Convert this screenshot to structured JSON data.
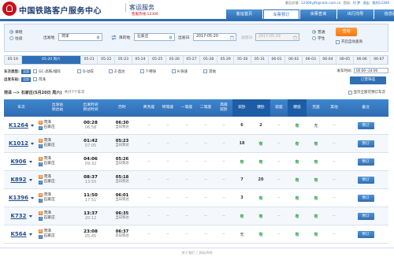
{
  "header": {
    "title": "中国铁路客户服务中心",
    "subtitle": "客运服务",
    "hotline": "客服热线:12306",
    "top_links": [
      "意见反馈:",
      "12306yjfk@rails.com.cn",
      "您好,",
      "刘 梦",
      "退出",
      "我的12306"
    ],
    "nav": [
      "客运首页",
      "车票预订",
      "余票查询",
      "出行向导",
      "信息服务"
    ]
  },
  "query": {
    "trip_types": [
      "单程",
      "往返"
    ],
    "from_label": "出发地",
    "from_value": "菏泽",
    "to_label": "目的地",
    "to_value": "石家庄",
    "date_label": "出发日",
    "date_value": "2017-05-20",
    "return_label": "返程日",
    "return_value": "2017-05-19",
    "passenger_types": [
      "普通",
      "学生"
    ],
    "search_label": "查询",
    "auto_query_label": "开启自动查询"
  },
  "date_tabs": [
    "05-19",
    "05-20 周六",
    "05-21",
    "05-22",
    "05-23",
    "05-24",
    "05-25",
    "05-26",
    "05-27",
    "05-28",
    "05-29",
    "05-30",
    "05-31",
    "06-01",
    "06-02",
    "06-03",
    "06-04",
    "06-05",
    "06-06",
    "06-07"
  ],
  "filters": {
    "type_label": "车次类型:",
    "station_label": "出发车站:",
    "all_label": "全部",
    "types": [
      "GC-高铁/城际",
      "D-动车",
      "Z-直达",
      "T-特快",
      "K-快速",
      "其他"
    ],
    "stations": [
      "菏泽"
    ],
    "depart_time_label": "发车时间:",
    "depart_time_value": "00:00--24:00",
    "filter_button": "订票筛选"
  },
  "route": {
    "text": "菏泽 --> 石家庄(5月20日 周六)",
    "count": "共计7个车次",
    "show_all": "显示全部可预订车次"
  },
  "table": {
    "headers": [
      "车次",
      "出发站\n到达站",
      "出发时间\n到达时间",
      "历时",
      "商务座",
      "特等座",
      "一等座",
      "二等座",
      "高级\n软卧",
      "软卧",
      "硬卧",
      "软座",
      "硬座",
      "无座",
      "其他",
      "备注"
    ],
    "rows": [
      {
        "train": "K1264",
        "from": "菏泽",
        "to": "石家庄",
        "dep": "00:28",
        "arr": "06:58",
        "dur": "06:30",
        "day": "当日到达",
        "seats": [
          "--",
          "--",
          "--",
          "--",
          "--",
          "6",
          "2",
          "--",
          "有",
          "无",
          "--"
        ],
        "book": "预订"
      },
      {
        "train": "K1012",
        "from": "菏泽",
        "to": "石家庄",
        "dep": "01:42",
        "arr": "07:05",
        "dur": "05:23",
        "day": "当日到达",
        "seats": [
          "--",
          "--",
          "--",
          "--",
          "--",
          "18",
          "有",
          "--",
          "有",
          "有",
          "--"
        ],
        "book": "预订"
      },
      {
        "train": "K906",
        "from": "菏泽",
        "to": "石家庄",
        "dep": "04:06",
        "arr": "09:32",
        "dur": "05:26",
        "day": "当日到达",
        "seats": [
          "--",
          "--",
          "--",
          "--",
          "--",
          "有",
          "有",
          "--",
          "有",
          "有",
          "--"
        ],
        "book": "预订"
      },
      {
        "train": "K892",
        "from": "菏泽",
        "to": "石家庄",
        "dep": "08:37",
        "arr": "13:55",
        "dur": "05:18",
        "day": "当日到达",
        "seats": [
          "--",
          "--",
          "--",
          "--",
          "--",
          "7",
          "20",
          "--",
          "有",
          "有",
          "--"
        ],
        "book": "预订"
      },
      {
        "train": "K1396",
        "from": "菏泽",
        "to": "石家庄",
        "dep": "11:50",
        "arr": "17:51",
        "dur": "06:01",
        "day": "当日到达",
        "seats": [
          "--",
          "--",
          "--",
          "--",
          "--",
          "3",
          "有",
          "--",
          "有",
          "有",
          "--"
        ],
        "book": "预订"
      },
      {
        "train": "K732",
        "from": "菏泽",
        "to": "石家庄",
        "dep": "13:37",
        "arr": "20:12",
        "dur": "06:35",
        "day": "当日到达",
        "seats": [
          "--",
          "--",
          "--",
          "--",
          "--",
          "有",
          "有",
          "--",
          "有",
          "有",
          "--"
        ],
        "book": "预订"
      },
      {
        "train": "K564",
        "from": "菏泽",
        "to": "石家庄",
        "dep": "23:08",
        "arr": "05:45",
        "dur": "06:37",
        "day": "次日到达",
        "seats": [
          "--",
          "--",
          "--",
          "--",
          "--",
          "无",
          "有",
          "--",
          "有",
          "有",
          "--"
        ],
        "book": "预订"
      }
    ]
  },
  "footer": {
    "links": [
      "关于我们",
      "网站声明"
    ]
  },
  "colors": {
    "brand_blue": "#2f6fb5",
    "accent_orange": "#f47a14",
    "logo_red": "#c8101a",
    "available_green": "#1a9a3a"
  }
}
